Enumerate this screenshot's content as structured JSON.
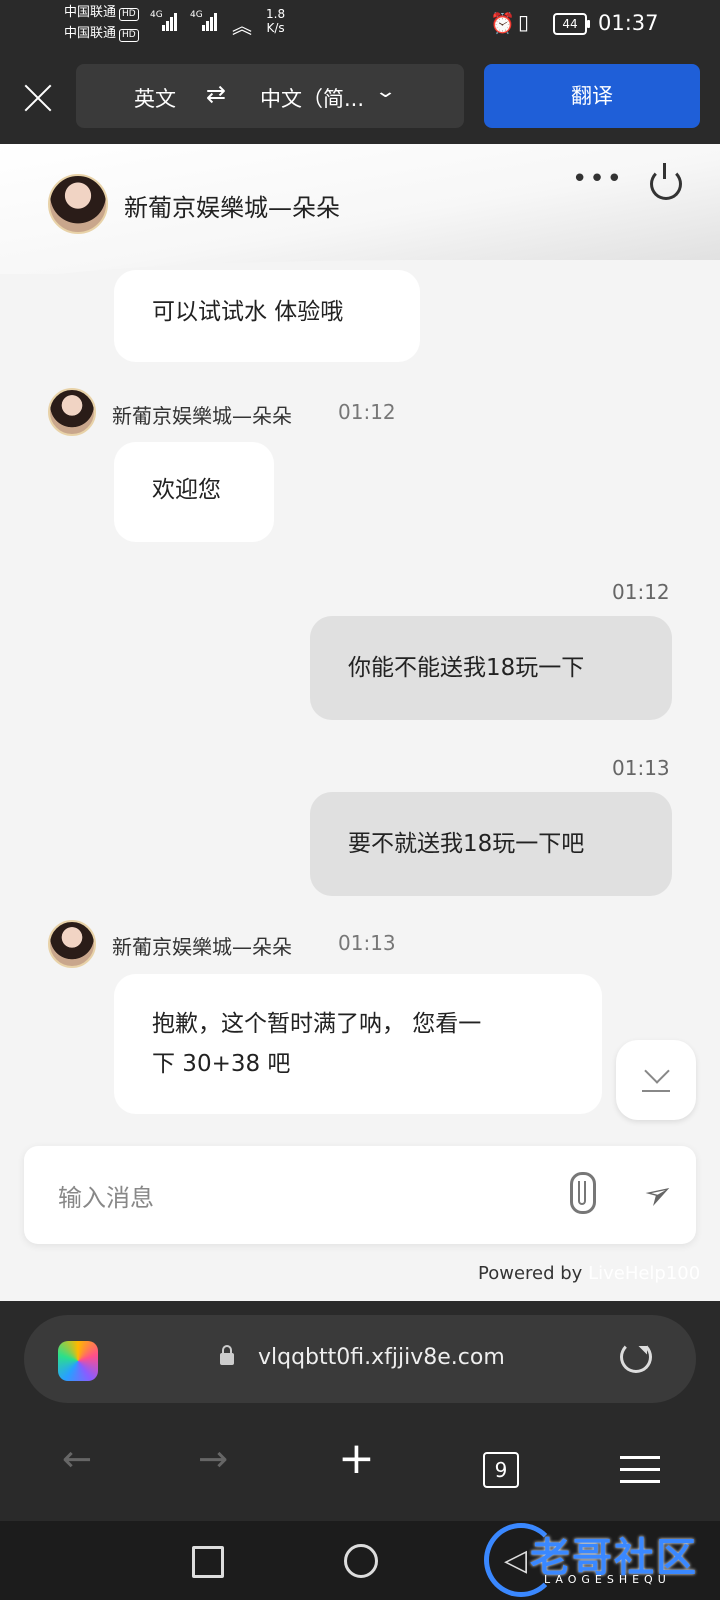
{
  "status_bar": {
    "carrier1": "中国联通",
    "carrier2": "中国联通",
    "hd": "HD",
    "net_type": "4G",
    "speed_value": "1.8",
    "speed_unit": "K/s",
    "battery": "44",
    "time": "01:37"
  },
  "translate_bar": {
    "source_lang": "英文",
    "swap_symbol": "⇄",
    "target_lang": "中文（简...",
    "translate_button": "翻译"
  },
  "chat_header": {
    "title": "新葡京娱樂城—朵朵",
    "more": "•••"
  },
  "messages": [
    {
      "dir": "in",
      "text": "可以试试水 体验哦"
    },
    {
      "dir": "in",
      "sender": "新葡京娱樂城—朵朵",
      "time": "01:12",
      "text": "欢迎您"
    },
    {
      "dir": "out",
      "time": "01:12",
      "text": "你能不能送我18玩一下"
    },
    {
      "dir": "out",
      "time": "01:13",
      "text": "要不就送我18玩一下吧"
    },
    {
      "dir": "in",
      "sender": "新葡京娱樂城—朵朵",
      "time": "01:13",
      "text_line1": "抱歉，这个暂时满了呐， 您看一",
      "text_line2": "下 30+38 吧"
    }
  ],
  "input": {
    "placeholder": "输入消息"
  },
  "footer": {
    "powered_by": "Powered by",
    "brand": "LiveHelp100"
  },
  "browser": {
    "url": "vlqqbtt0fi.xfjjiv8e.com",
    "tab_count": "9"
  },
  "watermark": {
    "title": "老哥社区",
    "subtitle": "LAOGESHEQU"
  }
}
